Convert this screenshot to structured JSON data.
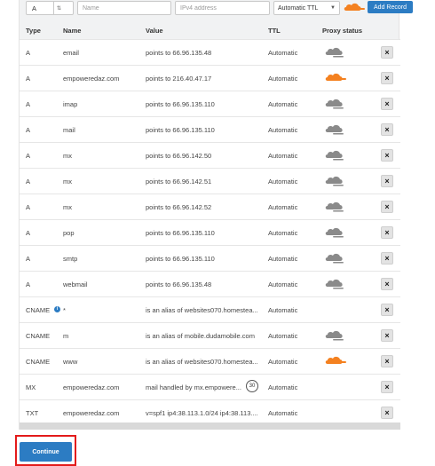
{
  "toolbar": {
    "type_value": "A",
    "name_placeholder": "Name",
    "address_placeholder": "IPv4 address",
    "ttl_value": "Automatic TTL",
    "add_label": "Add Record"
  },
  "columns": [
    "Type",
    "Name",
    "Value",
    "TTL",
    "Proxy status"
  ],
  "records": [
    {
      "type": "A",
      "name": "email",
      "value": "points to 66.96.135.48",
      "ttl": "Automatic",
      "proxy": "dns-only"
    },
    {
      "type": "A",
      "name": "empoweredaz.com",
      "value": "points to 216.40.47.17",
      "ttl": "Automatic",
      "proxy": "proxied"
    },
    {
      "type": "A",
      "name": "imap",
      "value": "points to 66.96.135.110",
      "ttl": "Automatic",
      "proxy": "dns-only"
    },
    {
      "type": "A",
      "name": "mail",
      "value": "points to 66.96.135.110",
      "ttl": "Automatic",
      "proxy": "dns-only"
    },
    {
      "type": "A",
      "name": "mx",
      "value": "points to 66.96.142.50",
      "ttl": "Automatic",
      "proxy": "dns-only"
    },
    {
      "type": "A",
      "name": "mx",
      "value": "points to 66.96.142.51",
      "ttl": "Automatic",
      "proxy": "dns-only"
    },
    {
      "type": "A",
      "name": "mx",
      "value": "points to 66.96.142.52",
      "ttl": "Automatic",
      "proxy": "dns-only"
    },
    {
      "type": "A",
      "name": "pop",
      "value": "points to 66.96.135.110",
      "ttl": "Automatic",
      "proxy": "dns-only"
    },
    {
      "type": "A",
      "name": "smtp",
      "value": "points to 66.96.135.110",
      "ttl": "Automatic",
      "proxy": "dns-only"
    },
    {
      "type": "A",
      "name": "webmail",
      "value": "points to 66.96.135.48",
      "ttl": "Automatic",
      "proxy": "dns-only"
    },
    {
      "type": "CNAME",
      "name": "*",
      "value": "is an alias of websites070.homestea...",
      "ttl": "Automatic",
      "proxy": "none",
      "info": "i"
    },
    {
      "type": "CNAME",
      "name": "m",
      "value": "is an alias of mobile.dudamobile.com",
      "ttl": "Automatic",
      "proxy": "dns-only"
    },
    {
      "type": "CNAME",
      "name": "www",
      "value": "is an alias of websites070.homestea...",
      "ttl": "Automatic",
      "proxy": "proxied"
    },
    {
      "type": "MX",
      "name": "empoweredaz.com",
      "value": "mail handled by mx.empowere...",
      "ttl": "Automatic",
      "proxy": "none",
      "priority": "30"
    },
    {
      "type": "TXT",
      "name": "empoweredaz.com",
      "value": "v=spf1 ip4:38.113.1.0/24 ip4:38.113....",
      "ttl": "Automatic",
      "proxy": "none"
    }
  ],
  "delete_symbol": "×",
  "continue_label": "Continue",
  "colors": {
    "accent": "#2c7cc3",
    "proxied": "#f48120",
    "dns_only": "#8a8a8a",
    "highlight": "#e31b1b"
  }
}
